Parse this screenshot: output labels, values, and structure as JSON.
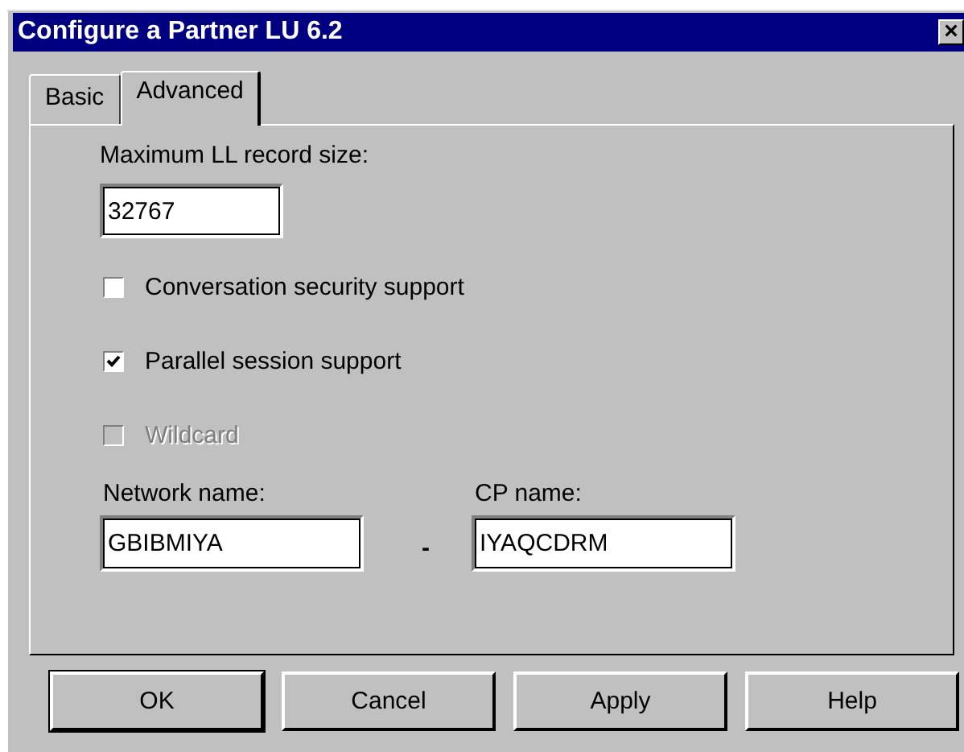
{
  "window": {
    "title": "Configure a Partner LU 6.2",
    "close": "×"
  },
  "tabs": [
    {
      "label": "Basic",
      "selected": false
    },
    {
      "label": "Advanced",
      "selected": true
    }
  ],
  "record_size": {
    "label": "Maximum LL record size:",
    "value": "32767"
  },
  "checkboxes": [
    {
      "label": "Conversation security support",
      "checked": false,
      "disabled": false
    },
    {
      "label": "Parallel session support",
      "checked": true,
      "disabled": false
    },
    {
      "label": "Wildcard",
      "checked": false,
      "disabled": true
    }
  ],
  "network_name": {
    "label": "Network name:",
    "value": "GBIBMIYA"
  },
  "separator": "-",
  "cp_name": {
    "label": "CP name:",
    "value": "IYAQCDRM"
  },
  "buttons": [
    {
      "label": "OK",
      "default": true
    },
    {
      "label": "Cancel",
      "default": false
    },
    {
      "label": "Apply",
      "default": false
    },
    {
      "label": "Help",
      "default": false
    }
  ]
}
